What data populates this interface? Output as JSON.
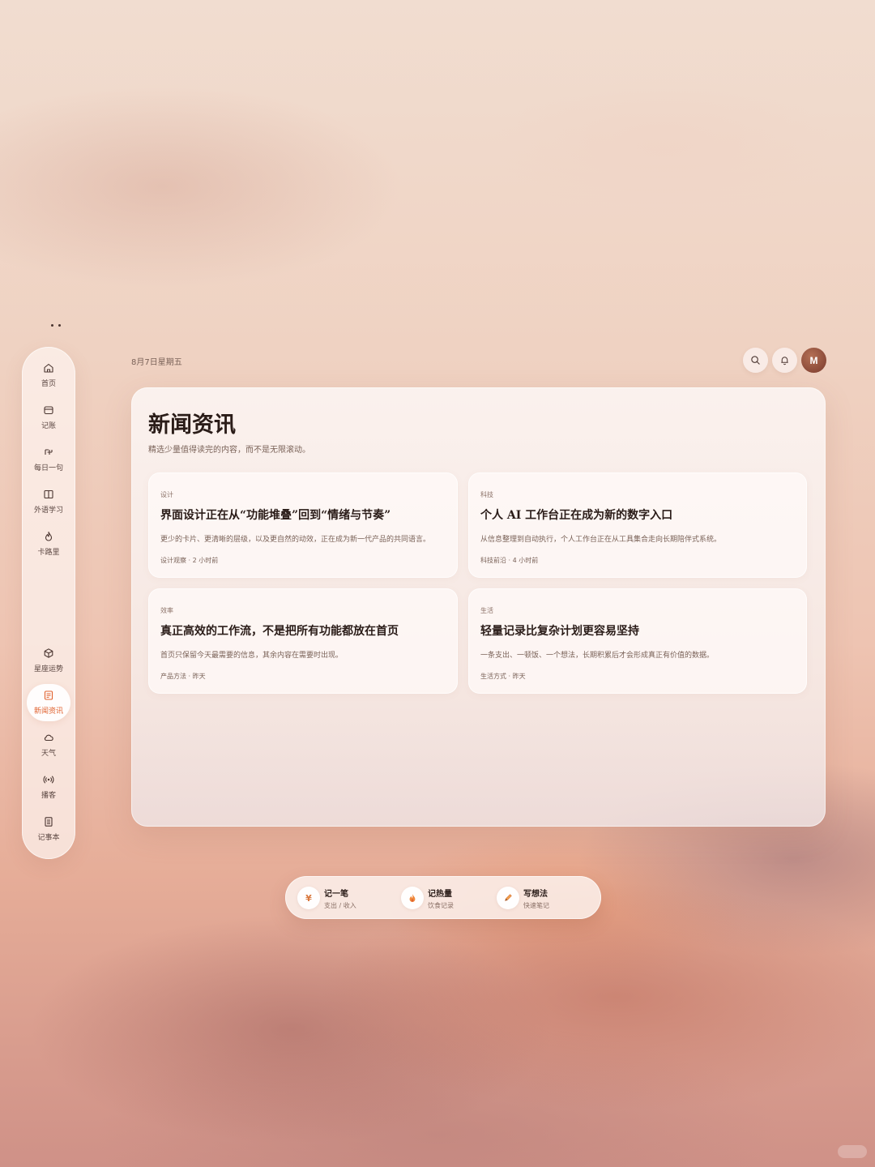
{
  "header": {
    "date": "8月7日星期五",
    "avatar_initial": "M"
  },
  "sidebar": {
    "items": [
      {
        "label": "首页",
        "icon": "home-icon"
      },
      {
        "label": "记账",
        "icon": "wallet-icon"
      },
      {
        "label": "每日一句",
        "icon": "quote-icon"
      },
      {
        "label": "外语学习",
        "icon": "book-icon"
      },
      {
        "label": "卡路里",
        "icon": "flame-icon"
      },
      {
        "label": "星座运势",
        "icon": "star-badge-icon"
      },
      {
        "label": "新闻资讯",
        "icon": "news-icon",
        "active": true
      },
      {
        "label": "天气",
        "icon": "cloud-icon"
      },
      {
        "label": "播客",
        "icon": "broadcast-icon"
      },
      {
        "label": "记事本",
        "icon": "notepad-icon"
      }
    ]
  },
  "main": {
    "title": "新闻资讯",
    "subtitle": "精选少量值得读完的内容，而不是无限滚动。",
    "articles": [
      {
        "category": "设计",
        "title": "界面设计正在从“功能堆叠”回到“情绪与节奏”",
        "summary": "更少的卡片、更清晰的层级，以及更自然的动效，正在成为新一代产品的共同语言。",
        "meta": "设计观察 · 2 小时前"
      },
      {
        "category": "科技",
        "title": "个人 AI 工作台正在成为新的数字入口",
        "summary": "从信息整理到自动执行，个人工作台正在从工具集合走向长期陪伴式系统。",
        "meta": "科技前沿 · 4 小时前"
      },
      {
        "category": "效率",
        "title": "真正高效的工作流，不是把所有功能都放在首页",
        "summary": "首页只保留今天最需要的信息，其余内容在需要时出现。",
        "meta": "产品方法 · 昨天"
      },
      {
        "category": "生活",
        "title": "轻量记录比复杂计划更容易坚持",
        "summary": "一条支出、一顿饭、一个想法，长期积累后才会形成真正有价值的数据。",
        "meta": "生活方式 · 昨天"
      }
    ]
  },
  "quickbar": {
    "items": [
      {
        "title": "记一笔",
        "subtitle": "支出 / 收入",
        "icon": "yen-icon",
        "glyph": "¥"
      },
      {
        "title": "记热量",
        "subtitle": "饮食记录",
        "icon": "flame-icon"
      },
      {
        "title": "写想法",
        "subtitle": "快速笔记",
        "icon": "pencil-icon"
      }
    ]
  },
  "colors": {
    "accent": "#e0612e",
    "avatar": "#8a4534"
  }
}
